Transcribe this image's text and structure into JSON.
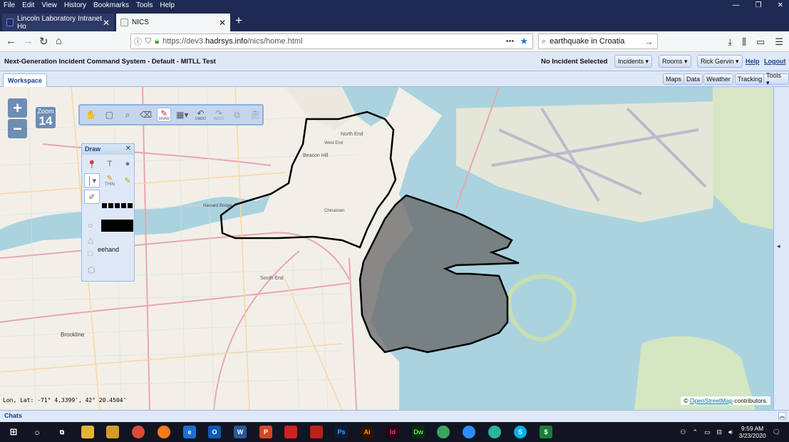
{
  "menu": [
    "File",
    "Edit",
    "View",
    "History",
    "Bookmarks",
    "Tools",
    "Help"
  ],
  "window_controls": [
    "—",
    "❐",
    "✕"
  ],
  "tabs": [
    {
      "title": "Lincoln Laboratory Intranet Ho"
    },
    {
      "title": "NICS"
    }
  ],
  "url": {
    "prefix": "https://dev3.",
    "domain": "hadrsys.info",
    "path": "/nics/home.html"
  },
  "search": {
    "value": "earthquake in Croatia"
  },
  "app": {
    "title": "Next-Generation Incident Command System - Default - MITLL Test",
    "incident_status": "No Incident Selected",
    "incidents_btn": "Incidents ▾",
    "rooms_btn": "Rooms ▾",
    "user_btn": "Rick Gervin ▾",
    "help": "Help",
    "logout": "Logout"
  },
  "workspace": {
    "tab": "Workspace",
    "buttons": [
      "Maps",
      "Data",
      "Weather",
      "Tracking",
      "Tools ▾"
    ]
  },
  "map": {
    "zoom_in": "+",
    "zoom_out": "−",
    "zoom_label": "Zoom",
    "zoom_level": "14",
    "coords": "Lon, Lat: -71° 4.3399', 42° 20.4504'",
    "attribution_prefix": "©",
    "attribution_link": "OpenStreetMap",
    "attribution_suffix": "contributors.",
    "labels": {
      "north_end": "North End",
      "beacon_hill": "Beacon Hill",
      "south_end": "South End",
      "brookline": "Brookline",
      "harvard_bridge": "Harvard Bridge",
      "west_end": "West End",
      "chinatown": "Chinatown"
    },
    "water_color": "#aad3df",
    "land_color": "#f2efe9",
    "polygon_fill": "#666666"
  },
  "toolbar": {
    "items": [
      "pan-icon",
      "select-box-icon",
      "zoom-icon",
      "eraser-icon",
      "draw-icon",
      "image-icon",
      "undo-icon",
      "redo-icon",
      "copy-icon",
      "paste-icon"
    ],
    "draw_label": "DRAW",
    "undo_label": "UNDO",
    "redo_label": "REDO"
  },
  "draw_panel": {
    "title": "Draw",
    "close": "✕",
    "thin_label": "THIN",
    "freehand_label": "eehand"
  },
  "chats": {
    "label": "Chats"
  },
  "taskbar": {
    "time": "9:59 AM",
    "date": "3/23/2020"
  }
}
